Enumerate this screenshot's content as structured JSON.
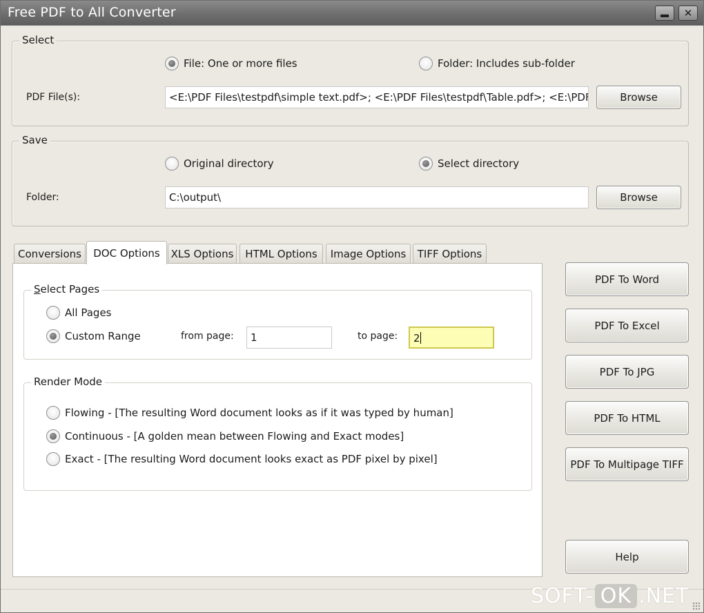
{
  "window": {
    "title": "Free PDF to All Converter"
  },
  "select_group": {
    "legend": "Select",
    "radio_file": "File:  One or more files",
    "radio_folder": "Folder: Includes sub-folder",
    "pdf_files_label": "PDF File(s):",
    "pdf_files_value": "<E:\\PDF Files\\testpdf\\simple text.pdf>; <E:\\PDF Files\\testpdf\\Table.pdf>; <E:\\PDF",
    "browse_label": "Browse",
    "selected": "file"
  },
  "save_group": {
    "legend": "Save",
    "radio_original": "Original directory",
    "radio_select": "Select directory",
    "folder_label": "Folder:",
    "folder_value": "C:\\output\\",
    "browse_label": "Browse",
    "selected": "select"
  },
  "tabs": [
    {
      "label": "Conversions"
    },
    {
      "label": "DOC Options"
    },
    {
      "label": "XLS Options"
    },
    {
      "label": "HTML Options"
    },
    {
      "label": "Image Options"
    },
    {
      "label": "TIFF Options"
    }
  ],
  "active_tab": "DOC Options",
  "doc_options": {
    "select_pages": {
      "legend": "Select Pages",
      "all_pages": "All Pages",
      "custom_range": "Custom Range",
      "from_label": "from page:",
      "from_value": "1",
      "to_label": "to page:",
      "to_value": "2",
      "selected": "custom"
    },
    "render_mode": {
      "legend": "Render Mode",
      "flowing": "Flowing - [The resulting Word document looks as if it was typed by human]",
      "continuous": "Continuous - [A golden mean between Flowing and Exact modes]",
      "exact": "Exact - [The resulting Word document looks exact as PDF pixel by pixel]",
      "selected": "continuous"
    }
  },
  "actions": {
    "to_word": "PDF To Word",
    "to_excel": "PDF To Excel",
    "to_jpg": "PDF To JPG",
    "to_html": "PDF To HTML",
    "to_tiff": "PDF To Multipage TIFF",
    "help": "Help"
  },
  "watermark": {
    "left": "SOFT-",
    "middle": "OK",
    "right": ".NET"
  },
  "colors": {
    "window_bg": "#ebe9e1",
    "titlebar": "#6e6e6e",
    "highlight_input": "#fdfdb5"
  }
}
